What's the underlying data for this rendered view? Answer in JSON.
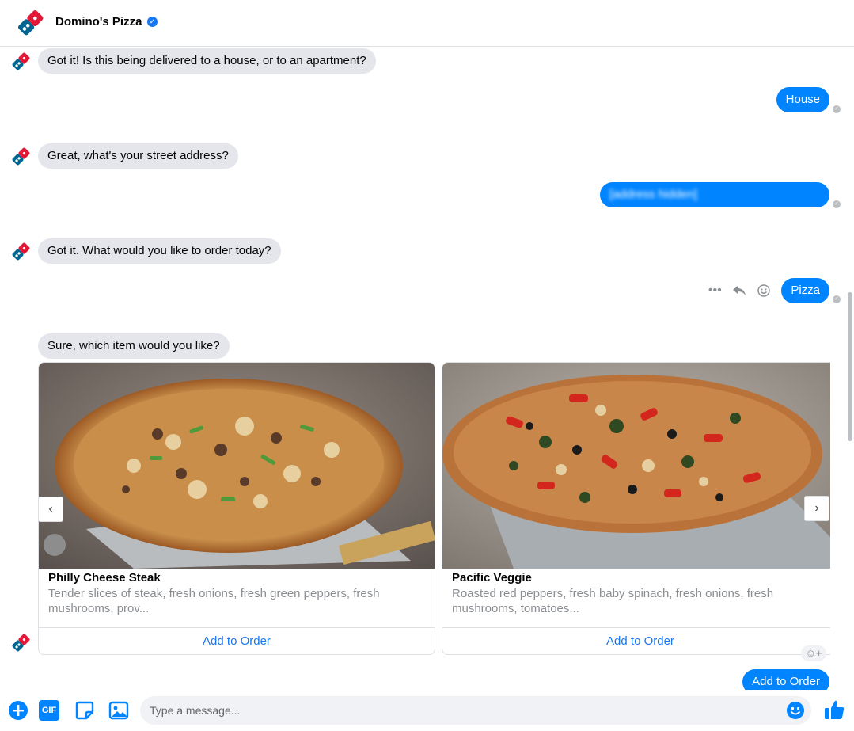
{
  "header": {
    "title": "Domino's Pizza",
    "verified_icon": "verified-badge-icon"
  },
  "messages": [
    {
      "from": "bot",
      "text": "Got it! Is this being delivered to a house, or to an apartment?"
    },
    {
      "from": "user",
      "text": "House"
    },
    {
      "from": "bot",
      "text": "Great, what's your street address?"
    },
    {
      "from": "user",
      "text": "[address hidden]"
    },
    {
      "from": "bot",
      "text": "Got it. What would you like to order today?"
    },
    {
      "from": "user",
      "text": "Pizza"
    },
    {
      "from": "bot",
      "text": "Sure, which item would you like?"
    },
    {
      "from": "user",
      "text": "Add to Order"
    }
  ],
  "cards": [
    {
      "title": "Philly Cheese Steak",
      "description": "Tender slices of steak, fresh onions, fresh green peppers, fresh mushrooms, prov...",
      "button": "Add to Order"
    },
    {
      "title": "Pacific Veggie",
      "description": "Roasted red peppers, fresh baby spinach, fresh onions, fresh mushrooms, tomatoes...",
      "button": "Add to Order"
    }
  ],
  "composer": {
    "placeholder": "Type a message...",
    "gif_label": "GIF"
  },
  "colors": {
    "accent": "#0084ff",
    "brand_blue": "#006491",
    "brand_red": "#e31837",
    "incoming_bubble": "#e4e6eb"
  }
}
